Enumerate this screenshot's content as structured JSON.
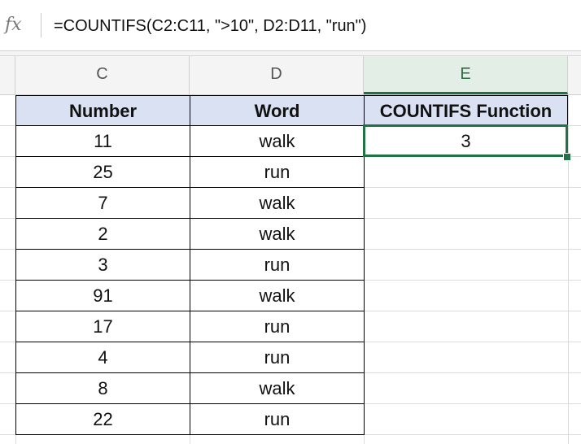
{
  "formula_bar": {
    "fx_label": "fx",
    "formula": "=COUNTIFS(C2:C11, \">10\", D2:D11, \"run\")"
  },
  "columns": [
    "C",
    "D",
    "E"
  ],
  "table": {
    "headers": [
      "Number",
      "Word",
      "COUNTIFS Function"
    ],
    "rows": [
      [
        "11",
        "walk",
        "3"
      ],
      [
        "25",
        "run",
        ""
      ],
      [
        "7",
        "walk",
        ""
      ],
      [
        "2",
        "walk",
        ""
      ],
      [
        "3",
        "run",
        ""
      ],
      [
        "91",
        "walk",
        ""
      ],
      [
        "17",
        "run",
        ""
      ],
      [
        "4",
        "run",
        ""
      ],
      [
        "8",
        "walk",
        ""
      ],
      [
        "22",
        "run",
        ""
      ]
    ]
  },
  "selected_cell": "E2",
  "colors": {
    "header_fill": "#d9e1f2",
    "selection": "#217346"
  }
}
